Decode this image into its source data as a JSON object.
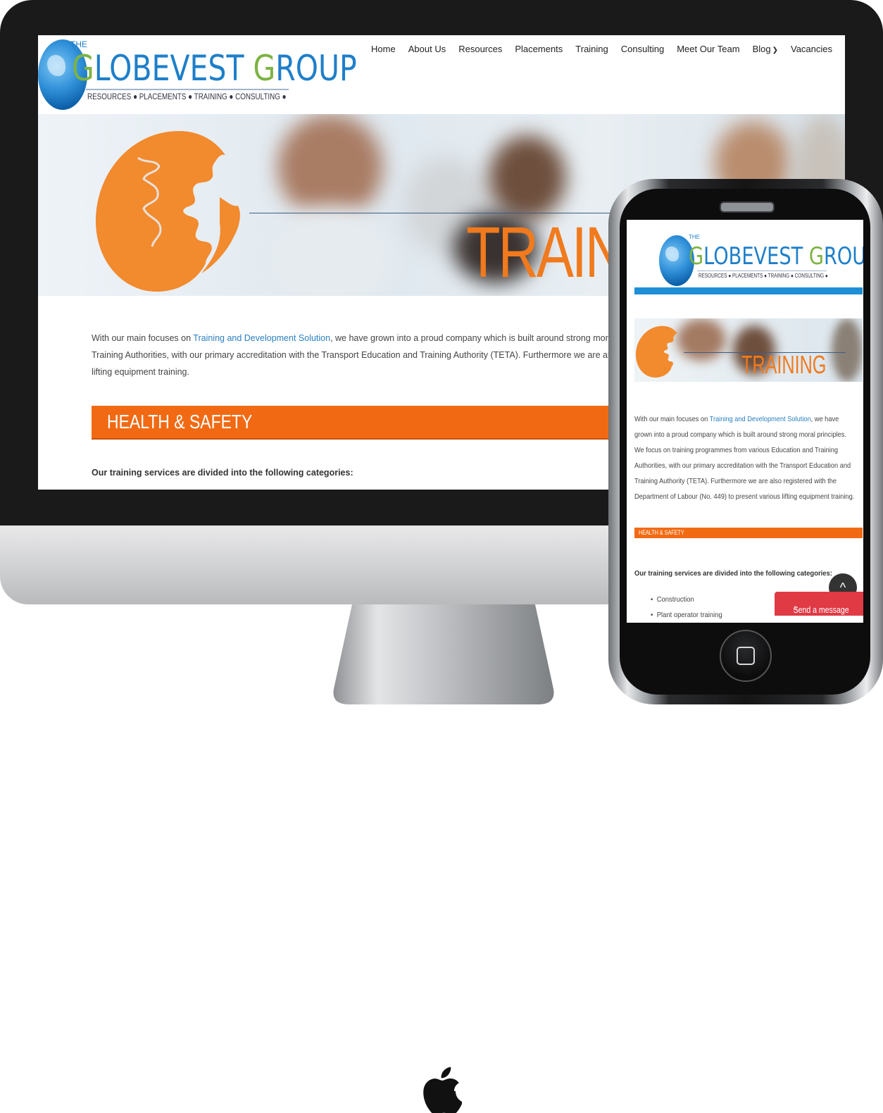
{
  "desktop": {
    "logo": {
      "the": "THE",
      "name_first_letter": "G",
      "name_rest_1": "LOBEVEST ",
      "name_second_letter": "G",
      "name_rest_2": "ROUP",
      "tagline": "RESOURCES ● PLACEMENTS ● TRAINING ● CONSULTING ●"
    },
    "nav": [
      "Home",
      "About Us",
      "Resources",
      "Placements",
      "Training",
      "Consulting",
      "Meet Our Team",
      "Blog",
      "Vacancies"
    ],
    "hero_title": "TRAIN",
    "intro_1": "With our main focuses on ",
    "intro_link": "Training and Development Solution",
    "intro_2": ", we have grown into a proud company which is built around strong moral",
    "intro_line2": "Training Authorities, with our primary accreditation with the Transport Education and Training Authority (TETA). Furthermore we are also",
    "intro_line3": "lifting equipment training.",
    "section_title": "HEALTH & SAFETY",
    "categories_heading": "Our training services are divided into the following categories:"
  },
  "mobile": {
    "logo": {
      "the": "THE",
      "name_first_letter": "G",
      "name_rest_1": "LOBEVEST ",
      "name_second_letter": "G",
      "name_rest_2": "ROUP",
      "tagline": "RESOURCES ● PLACEMENTS ● TRAINING ● CONSULTING ●"
    },
    "hero_title": "TRAINING",
    "intro_1": "With our main focuses on ",
    "intro_link": "Training and Development Solution",
    "intro_2": ", we have",
    "intro_lines": [
      "grown into a proud company which is built around strong moral principles.",
      "We focus on training programmes from various Education and Training",
      "Authorities, with our primary accreditation with the Transport Education and",
      "Training Authority (TETA). Furthermore we are also registered with the",
      "Department of Labour (No. 449) to present various lifting equipment training."
    ],
    "section_title": "HEALTH & SAFETY",
    "categories_heading": "Our training services are divided into the following categories:",
    "categories": [
      "Construction",
      "Plant operator training"
    ],
    "send_message": "Send a message",
    "send_chevron": "^",
    "up_arrow": "^"
  },
  "colors": {
    "orange": "#f16a13",
    "blue": "#1e8fd6",
    "green": "#7cb342",
    "link": "#2a7fc0",
    "send": "#e03a45"
  },
  "icons": {
    "apple": "apple-logo-icon",
    "home": "home-button-icon",
    "up": "scroll-top-icon"
  }
}
